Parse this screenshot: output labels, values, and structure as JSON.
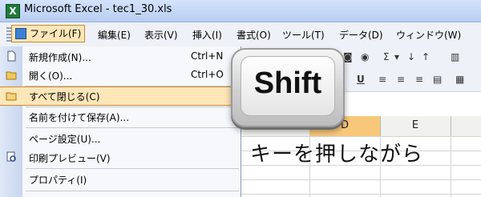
{
  "window": {
    "title": "Microsoft Excel - tec1_30.xls",
    "app_icon_text": "X"
  },
  "menubar": {
    "items": [
      {
        "label": "ファイル(F)"
      },
      {
        "label": "編集(E)"
      },
      {
        "label": "表示(V)"
      },
      {
        "label": "挿入(I)"
      },
      {
        "label": "書式(O)"
      },
      {
        "label": "ツール(T)"
      },
      {
        "label": "データ(D)"
      },
      {
        "label": "ウィンドウ(W)"
      }
    ]
  },
  "file_menu": {
    "items": [
      {
        "label": "新規作成(N)...",
        "shortcut": "Ctrl+N",
        "icon": "new-file-icon"
      },
      {
        "label": "開く(O)...",
        "shortcut": "Ctrl+O",
        "icon": "open-folder-icon"
      },
      {
        "label": "すべて閉じる(C)",
        "shortcut": "",
        "icon": "folder-icon",
        "highlighted": true
      },
      {
        "label": "名前を付けて保存(A)...",
        "shortcut": "",
        "icon": ""
      },
      {
        "label": "ページ設定(U)...",
        "shortcut": "",
        "icon": ""
      },
      {
        "label": "印刷プレビュー(V)",
        "shortcut": "",
        "icon": "print-preview-icon"
      },
      {
        "label": "プロパティ(I)",
        "shortcut": "",
        "icon": ""
      }
    ]
  },
  "sheet": {
    "columns": [
      "D",
      "E"
    ],
    "selected_column": "D"
  },
  "overlay": {
    "key_label": "Shift",
    "caption": "キーを押しながら"
  },
  "colors": {
    "menu_highlight": "#fde6b8",
    "highlight_border": "#c98a2d",
    "selected_col": "#f8c87a"
  }
}
